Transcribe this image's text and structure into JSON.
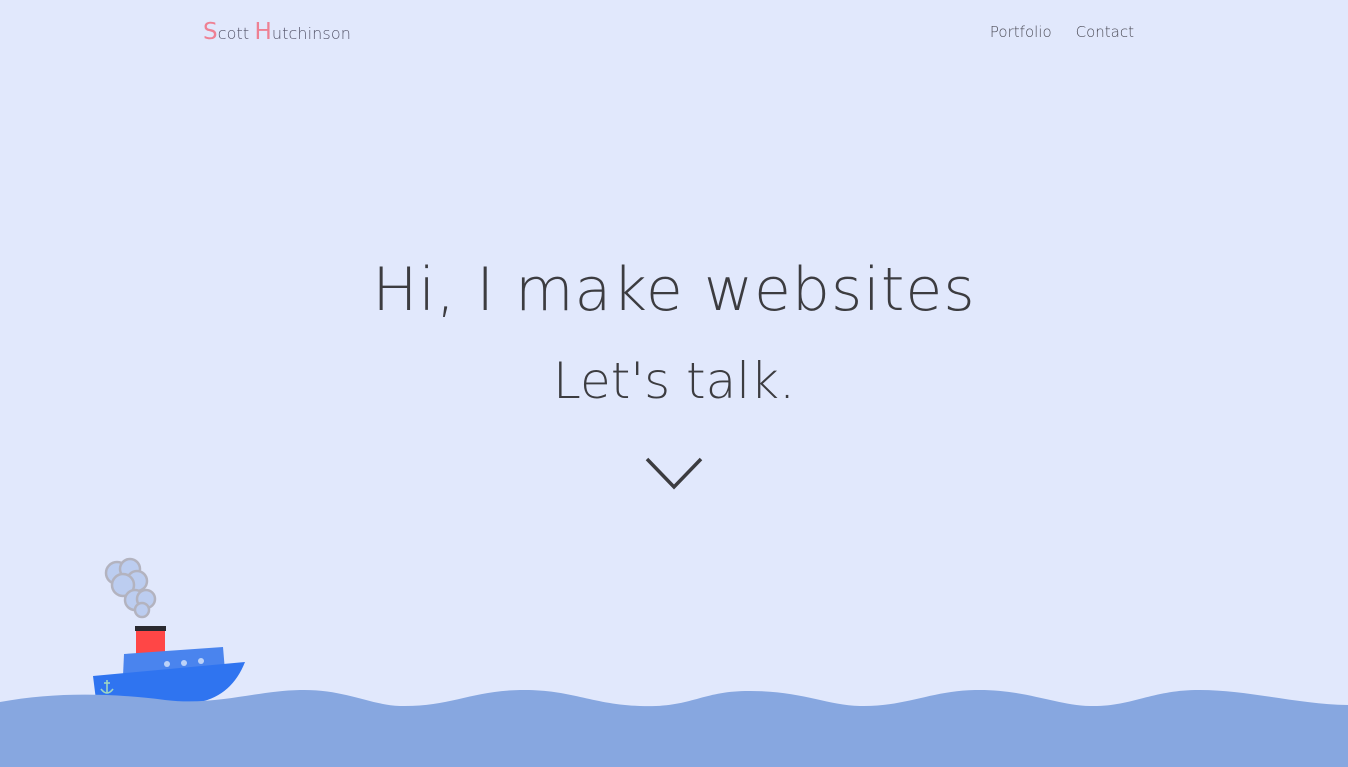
{
  "header": {
    "logo": {
      "first_initial": "S",
      "first_rest": "cott",
      "last_initial": "H",
      "last_rest": "utchinson"
    },
    "nav": [
      "Portfolio",
      "Contact"
    ]
  },
  "hero": {
    "title": "Hi, I make websites",
    "subtitle": "Let's talk."
  },
  "colors": {
    "background": "#e1e8fc",
    "accent": "#ee8093",
    "wave": "#87a7e0",
    "text": "#3c3c40"
  },
  "icons": {
    "scroll": "chevron-down-icon",
    "boat": "boat-illustration"
  }
}
